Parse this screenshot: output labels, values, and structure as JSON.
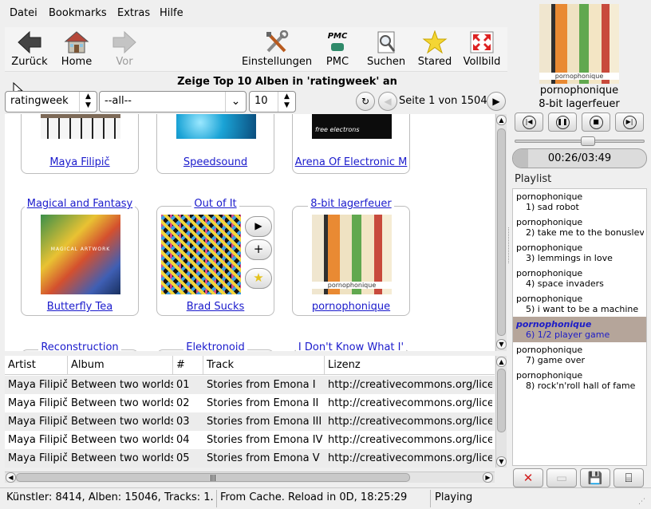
{
  "menu": [
    "Datei",
    "Bookmarks",
    "Extras",
    "Hilfe"
  ],
  "toolbar": {
    "back": "Zurück",
    "home": "Home",
    "forward": "Vor",
    "settings": "Einstellungen",
    "pmc": "PMC",
    "pmc_icon_text": "PMC",
    "search": "Suchen",
    "stared": "Stared",
    "fullscreen": "Vollbild"
  },
  "page_title": "Zeige Top 10 Alben in 'ratingweek' an",
  "filters": {
    "period": "ratingweek",
    "genre": "--all--",
    "count": "10",
    "page_info": "Seite 1 von 1504"
  },
  "albums": [
    {
      "title": "",
      "artist": "Maya Filipič"
    },
    {
      "title": "",
      "artist": "Speedsound"
    },
    {
      "title": "",
      "artist": "Arena Of Electronic M"
    },
    {
      "title": "Magical and Fantasy",
      "artist": "Butterfly Tea"
    },
    {
      "title": "Out of It",
      "artist": "Brad Sucks"
    },
    {
      "title": "8-bit lagerfeuer",
      "artist": "pornophonique"
    },
    {
      "title": "Reconstruction",
      "artist": ""
    },
    {
      "title": "Elektronoid",
      "artist": ""
    },
    {
      "title": "I Don't Know What I'",
      "artist": ""
    }
  ],
  "cover_texts": {
    "free_electrons": "free electrons",
    "magical": "MAGICAL ARTWORK",
    "porno": "pornophonique"
  },
  "table": {
    "headers": [
      "Artist",
      "Album",
      "#",
      "Track",
      "Lizenz"
    ],
    "rows": [
      [
        "Maya Filipič",
        "Between two worlds",
        "01",
        "Stories from Emona I",
        "http://creativecommons.org/licen"
      ],
      [
        "Maya Filipič",
        "Between two worlds",
        "02",
        "Stories from Emona II",
        "http://creativecommons.org/licen"
      ],
      [
        "Maya Filipič",
        "Between two worlds",
        "03",
        "Stories from Emona III",
        "http://creativecommons.org/licen"
      ],
      [
        "Maya Filipič",
        "Between two worlds",
        "04",
        "Stories from Emona IV",
        "http://creativecommons.org/licen"
      ],
      [
        "Maya Filipič",
        "Between two worlds",
        "05",
        "Stories from Emona V",
        "http://creativecommons.org/licen"
      ]
    ]
  },
  "status": {
    "counts": "Künstler: 8414, Alben: 15046, Tracks: 1...",
    "cache": "From Cache. Reload in 0D, 18:25:29",
    "state": "Playing"
  },
  "now_playing": {
    "artist": "pornophonique",
    "album": "8-bit lagerfeuer",
    "time": "00:26/03:49",
    "progress": 0.113,
    "cover_text": "pornophonique"
  },
  "playlist_label": "Playlist",
  "playlist": [
    {
      "artist": "pornophonique",
      "title": "1) sad robot"
    },
    {
      "artist": "pornophonique",
      "title": "2) take me to the bonuslev"
    },
    {
      "artist": "pornophonique",
      "title": "3) lemmings in love"
    },
    {
      "artist": "pornophonique",
      "title": "4) space invaders"
    },
    {
      "artist": "pornophonique",
      "title": "5) i want to be a machine"
    },
    {
      "artist": "pornophonique",
      "title": "6) 1/2 player game"
    },
    {
      "artist": "pornophonique",
      "title": "7) game over"
    },
    {
      "artist": "pornophonique",
      "title": "8) rock'n'roll hall of fame"
    }
  ],
  "colors": {
    "link": "#1a1acc",
    "active_row": "#b5a59a"
  }
}
